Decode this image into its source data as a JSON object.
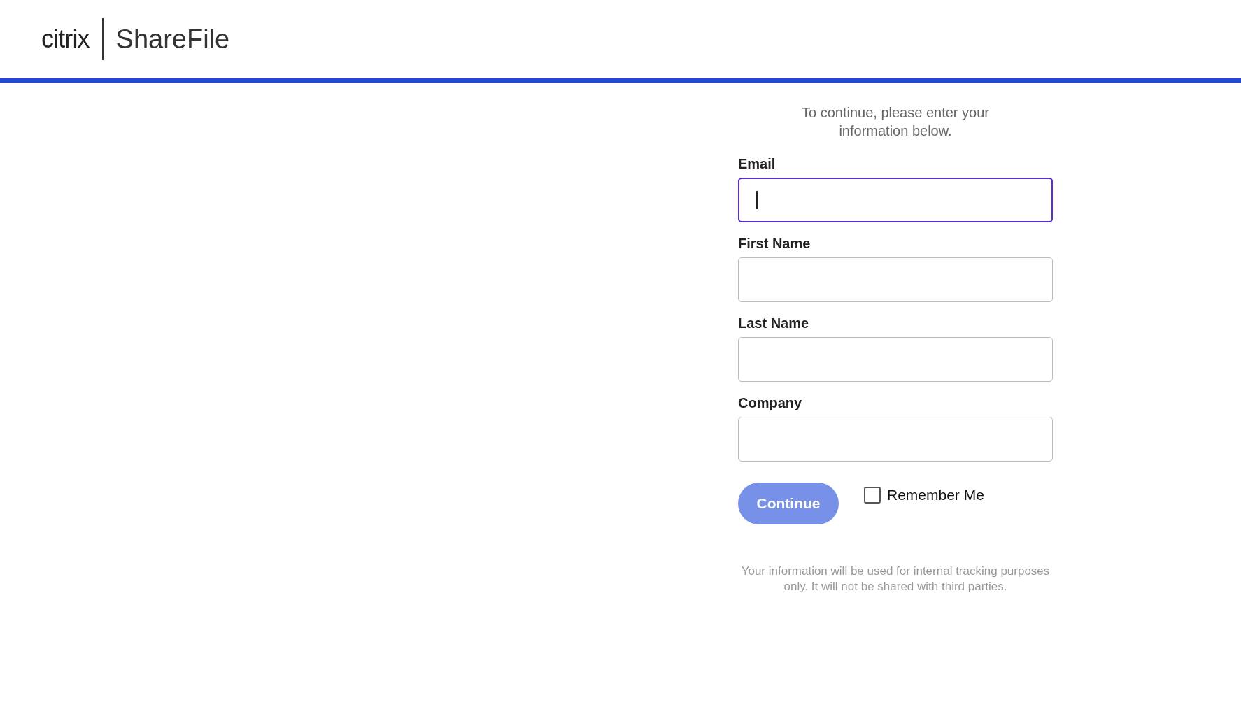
{
  "header": {
    "logo_left": "citrix",
    "logo_right": "ShareFile"
  },
  "intro": "To continue, please enter your information below.",
  "fields": [
    {
      "label": "Email",
      "focused": true
    },
    {
      "label": "First Name",
      "focused": false
    },
    {
      "label": "Last Name",
      "focused": false
    },
    {
      "label": "Company",
      "focused": false
    }
  ],
  "continue_button": {
    "label": "Continue",
    "disabled": true
  },
  "remember_me": {
    "label": "Remember Me",
    "checked": false
  },
  "footer_note": "Your information will be used for internal tracking purposes only. It will not be shared with third parties."
}
